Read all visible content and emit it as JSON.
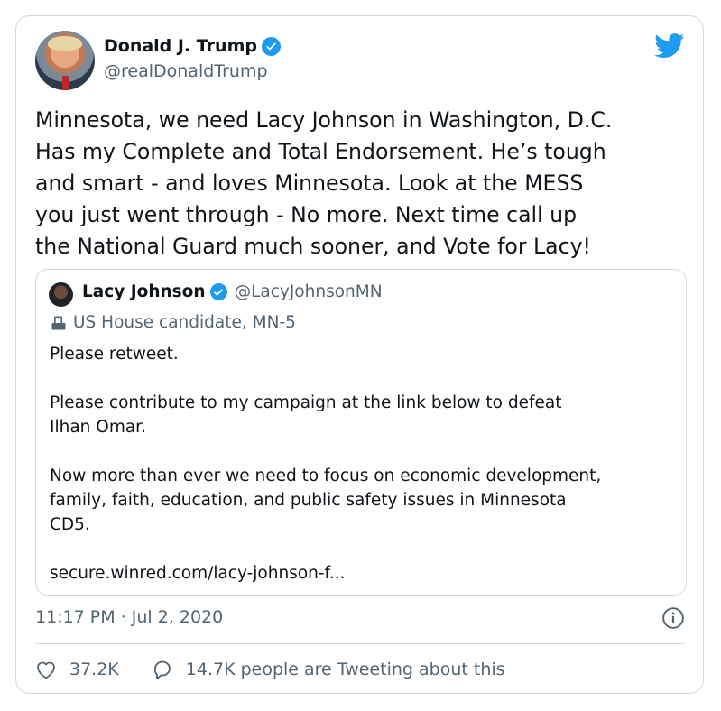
{
  "tweet": {
    "author_name": "Donald J. Trump",
    "author_handle": "@realDonaldTrump",
    "text_lines": [
      "Minnesota, we need Lacy Johnson in Washington, D.C.",
      "Has my Complete and Total Endorsement. He’s tough",
      "and smart - and loves Minnesota. Look at the MESS",
      "you just went through - No more. Next time call up",
      "the National Guard much sooner, and Vote for Lacy!"
    ],
    "timestamp": "11:17 PM · Jul 2, 2020",
    "likes": "37.2K",
    "tweeting": "14.7K people are Tweeting about this"
  },
  "quoted": {
    "author_name": "Lacy Johnson",
    "author_handle": "@LacyJohnsonMN",
    "label": "US House candidate, MN-5",
    "body_lines": [
      "Please retweet.",
      "",
      "Please contribute to my campaign at the link below to defeat",
      "Ilhan Omar.",
      "",
      "Now more than ever we need to focus on economic development,",
      "family, faith, education, and public safety issues in Minnesota",
      "CD5.",
      "",
      "secure.winred.com/lacy-johnson-f..."
    ]
  },
  "icons": {
    "verified": "verified-badge-icon",
    "brand": "twitter-bird-icon",
    "label": "ballot-box-icon",
    "info": "info-icon",
    "like": "heart-icon",
    "reply": "speech-bubble-icon"
  },
  "colors": {
    "accent": "#1d9bf0",
    "text": "#0f1419",
    "secondary": "#536471",
    "border": "#cfd9de"
  }
}
